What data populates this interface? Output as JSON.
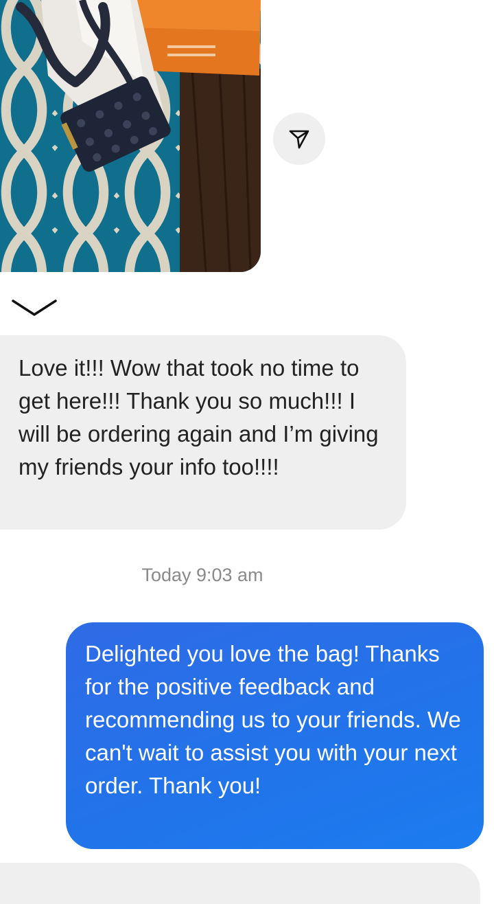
{
  "thread": {
    "incoming_message": "Love it!!! Wow that took no time to get here!!! Thank you so much!!! I will be ordering again and I’m giving my friends your info too!!!!",
    "timestamp": "Today 9:03 am",
    "outgoing_message": "Delighted you love the bag! Thanks for the positive feedback and recommending us to your friends. We can't wait to assist you with your next order. Thank you!"
  },
  "icons": {
    "share": "send-icon",
    "collapse": "chevron-down-icon"
  },
  "colors": {
    "outgoing_bubble": "#2174ea",
    "incoming_bubble": "#efefef",
    "timestamp": "#8a8a8a"
  }
}
